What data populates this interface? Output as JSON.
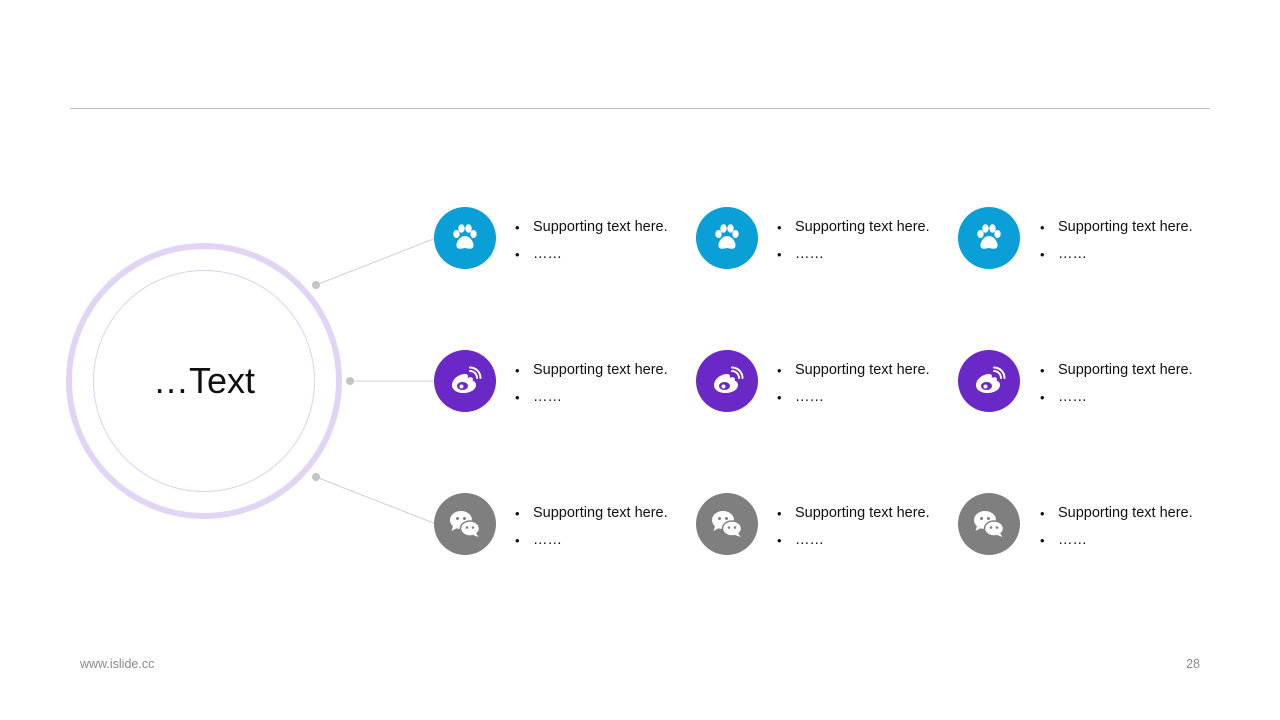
{
  "hub": {
    "label": "…Text"
  },
  "rows": [
    {
      "icon": "paw-icon",
      "color": "#0aa0d7",
      "items": [
        {
          "line1": "Supporting text here.",
          "line2": "……"
        },
        {
          "line1": "Supporting text here.",
          "line2": "……"
        },
        {
          "line1": "Supporting text here.",
          "line2": "……"
        }
      ]
    },
    {
      "icon": "weibo-icon",
      "color": "#6a28c6",
      "items": [
        {
          "line1": "Supporting text here.",
          "line2": "……"
        },
        {
          "line1": "Supporting text here.",
          "line2": "……"
        },
        {
          "line1": "Supporting text here.",
          "line2": "……"
        }
      ]
    },
    {
      "icon": "wechat-icon",
      "color": "#7f7f7f",
      "items": [
        {
          "line1": "Supporting text here.",
          "line2": "……"
        },
        {
          "line1": "Supporting text here.",
          "line2": "……"
        },
        {
          "line1": "Supporting text here.",
          "line2": "……"
        }
      ]
    }
  ],
  "footer": {
    "website": "www.islide.cc",
    "page_number": "28"
  }
}
